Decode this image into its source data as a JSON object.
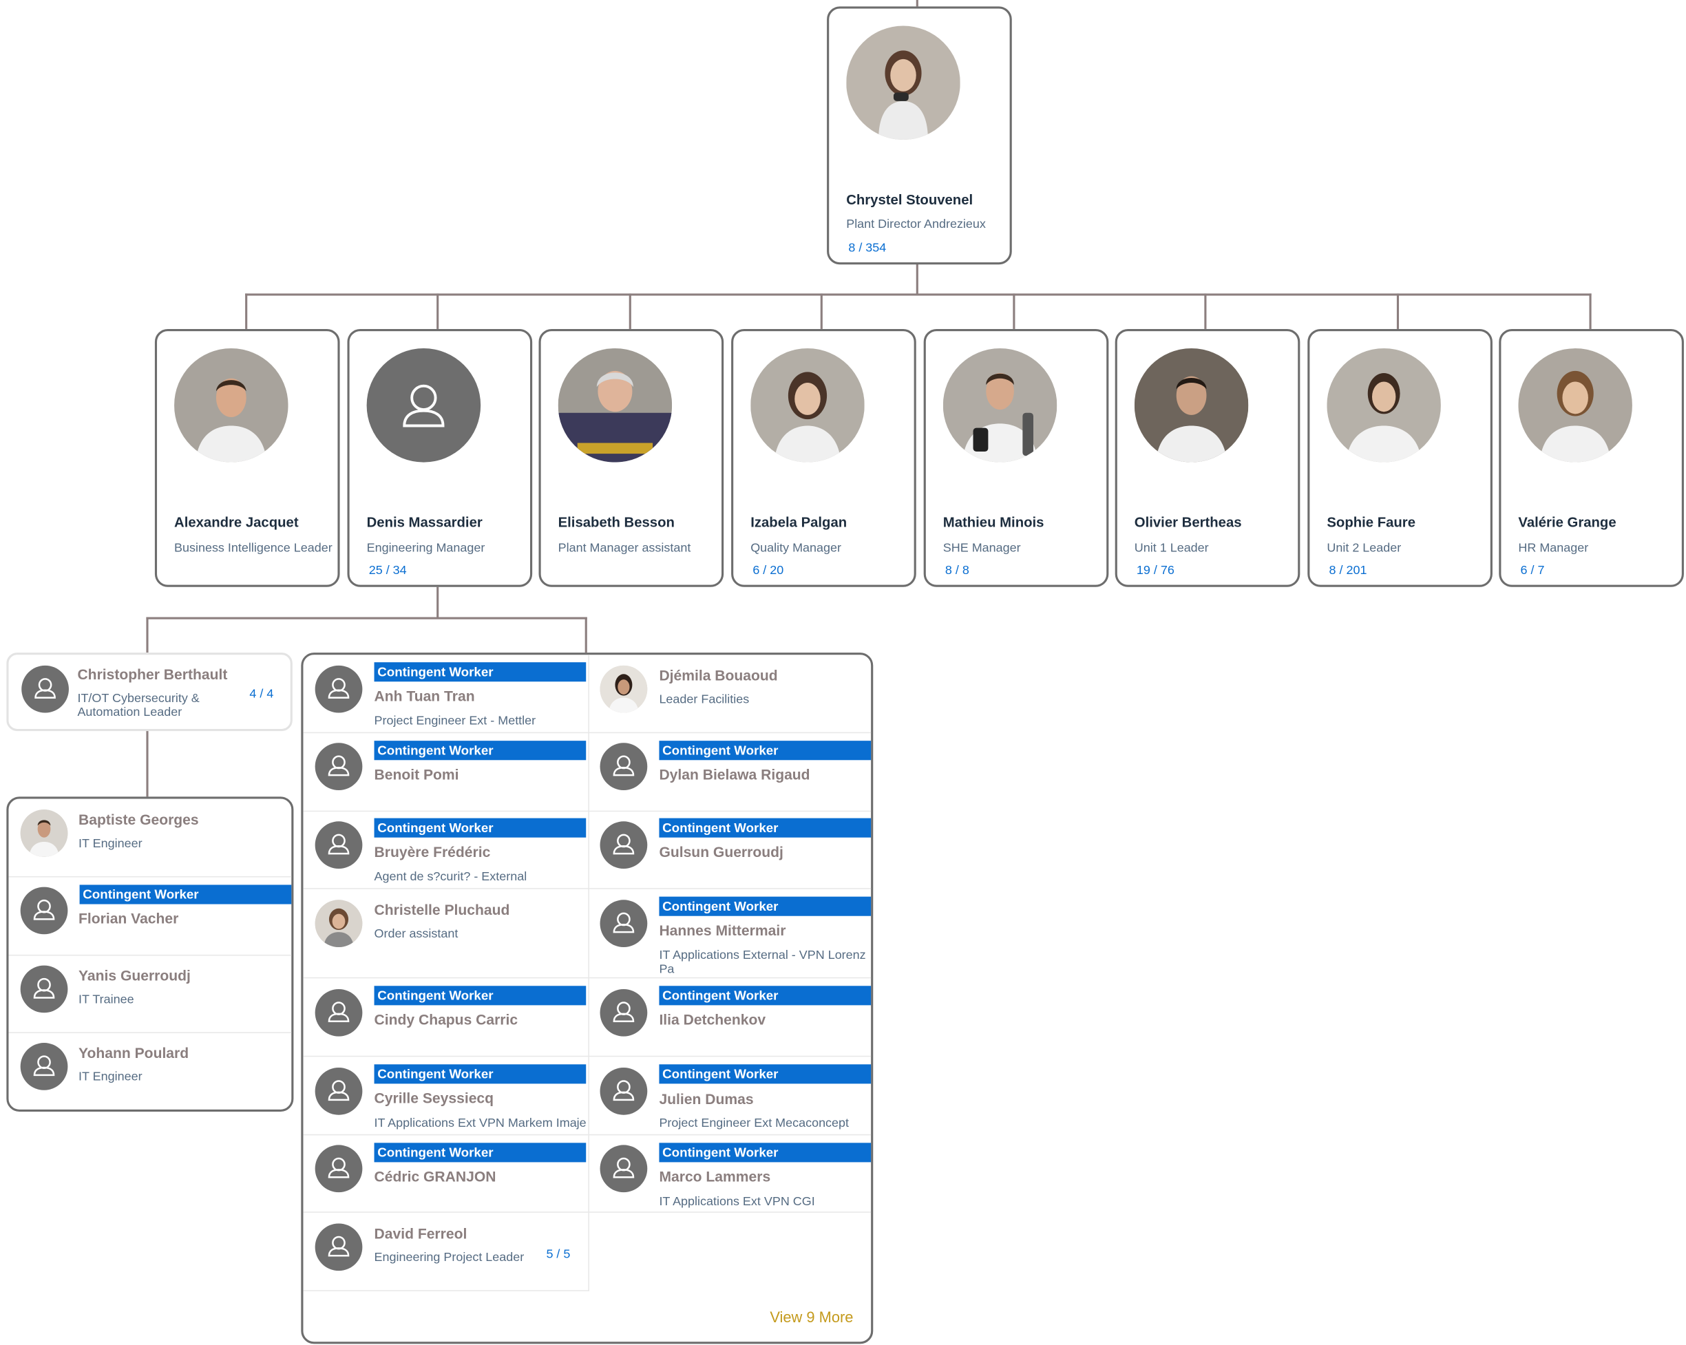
{
  "colors": {
    "accent": "#0a6ed1",
    "line": "#8c7f7f",
    "placeholder": "#6e6e6e",
    "link": "#c49a1c"
  },
  "root": {
    "name": "Chrystel Stouvenel",
    "title": "Plant Director Andrezieux",
    "count": "8 / 354",
    "icon": "photo-woman"
  },
  "reports": [
    {
      "name": "Alexandre Jacquet",
      "title": "Business Intelligence Leader",
      "count": ""
    },
    {
      "name": "Denis Massardier",
      "title": "Engineering Manager",
      "count": "25 / 34"
    },
    {
      "name": "Elisabeth Besson",
      "title": "Plant Manager assistant",
      "count": ""
    },
    {
      "name": "Izabela Palgan",
      "title": "Quality Manager",
      "count": "6 / 20"
    },
    {
      "name": "Mathieu Minois",
      "title": "SHE Manager",
      "count": "8 / 8"
    },
    {
      "name": "Olivier Bertheas",
      "title": "Unit 1 Leader",
      "count": "19 / 76"
    },
    {
      "name": "Sophie Faure",
      "title": "Unit 2 Leader",
      "count": "8 / 201"
    },
    {
      "name": "Valérie Grange",
      "title": "HR Manager",
      "count": "6 / 7"
    }
  ],
  "christopher": {
    "name": "Christopher Berthault",
    "title": "IT/OT Cybersecurity & Automation Leader",
    "count": "4 / 4"
  },
  "chris_team": [
    {
      "name": "Baptiste Georges",
      "title": "IT Engineer",
      "banner": ""
    },
    {
      "name": "Florian Vacher",
      "title": "",
      "banner": "Contingent Worker"
    },
    {
      "name": "Yanis Guerroudj",
      "title": "IT Trainee",
      "banner": ""
    },
    {
      "name": "Yohann Poulard",
      "title": "IT Engineer",
      "banner": ""
    }
  ],
  "denis_team": [
    {
      "name": "Anh Tuan Tran",
      "title": "Project Engineer Ext - Mettler",
      "banner": "Contingent Worker"
    },
    {
      "name": "Djémila Bouaoud",
      "title": "Leader Facilities",
      "banner": ""
    },
    {
      "name": "Benoit Pomi",
      "title": "",
      "banner": "Contingent Worker"
    },
    {
      "name": "Dylan Bielawa Rigaud",
      "title": "",
      "banner": "Contingent Worker"
    },
    {
      "name": "Bruyère Frédéric",
      "title": "Agent de s?curit? - External",
      "banner": "Contingent Worker"
    },
    {
      "name": "Gulsun Guerroudj",
      "title": "",
      "banner": "Contingent Worker"
    },
    {
      "name": "Christelle Pluchaud",
      "title": "Order assistant",
      "banner": ""
    },
    {
      "name": "Hannes Mittermair",
      "title": "IT Applications External - VPN Lorenz Pa",
      "banner": "Contingent Worker"
    },
    {
      "name": "Cindy Chapus Carric",
      "title": "",
      "banner": "Contingent Worker"
    },
    {
      "name": "Ilia Detchenkov",
      "title": "",
      "banner": "Contingent Worker"
    },
    {
      "name": "Cyrille Seyssiecq",
      "title": "IT Applications Ext VPN Markem Imaje",
      "banner": "Contingent Worker"
    },
    {
      "name": "Julien Dumas",
      "title": "Project Engineer Ext Mecaconcept",
      "banner": "Contingent Worker"
    },
    {
      "name": "Cédric GRANJON",
      "title": "",
      "banner": "Contingent Worker"
    },
    {
      "name": "Marco Lammers",
      "title": "IT Applications Ext VPN CGI",
      "banner": "Contingent Worker"
    },
    {
      "name": "David Ferreol",
      "title": "Engineering Project Leader",
      "banner": "",
      "count": "5 / 5"
    }
  ],
  "view_more": "View 9 More"
}
